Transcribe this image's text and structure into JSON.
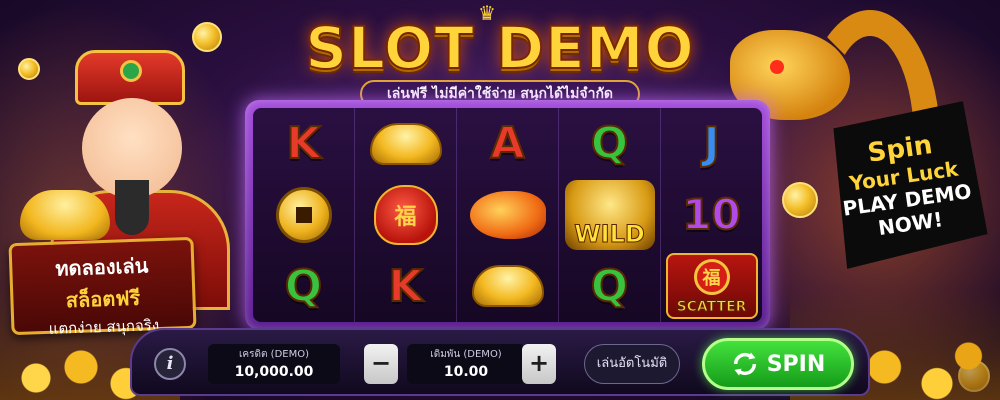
{
  "title": "SLOT DEMO",
  "subtitle": "เล่นฟรี ไม่มีค่าใช้จ่าย สนุกได้ไม่จำกัด",
  "promo_left": {
    "line1": "ทดลองเล่น",
    "line2": "สล็อตฟรี",
    "line3": "แตกง่าย สนุกจริง"
  },
  "promo_right": {
    "line1": "Spin",
    "line2": "Your Luck",
    "line3": "PLAY DEMO",
    "line4": "NOW!"
  },
  "reels": [
    [
      "K",
      "coin",
      "Q"
    ],
    [
      "ingot",
      "bag",
      "K"
    ],
    [
      "A",
      "fish",
      "ingot"
    ],
    [
      "Q",
      "WILD",
      "Q"
    ],
    [
      "J",
      "10",
      "SCATTER"
    ]
  ],
  "symbols": {
    "bag_char": "福",
    "scatter_char": "福",
    "wild_label": "WILD",
    "scatter_label": "SCATTER"
  },
  "controls": {
    "info_label": "i",
    "credit_label": "เครดิต (DEMO)",
    "credit_value": "10,000.00",
    "bet_label": "เดิมพัน (DEMO)",
    "bet_value": "10.00",
    "minus_label": "−",
    "plus_label": "+",
    "auto_label": "เล่นอัตโนมัติ",
    "spin_label": "SPIN"
  },
  "colors": {
    "spin_green": "#2bc22a",
    "gold": "#ffd43b",
    "frame_purple": "#8a3fc7"
  }
}
